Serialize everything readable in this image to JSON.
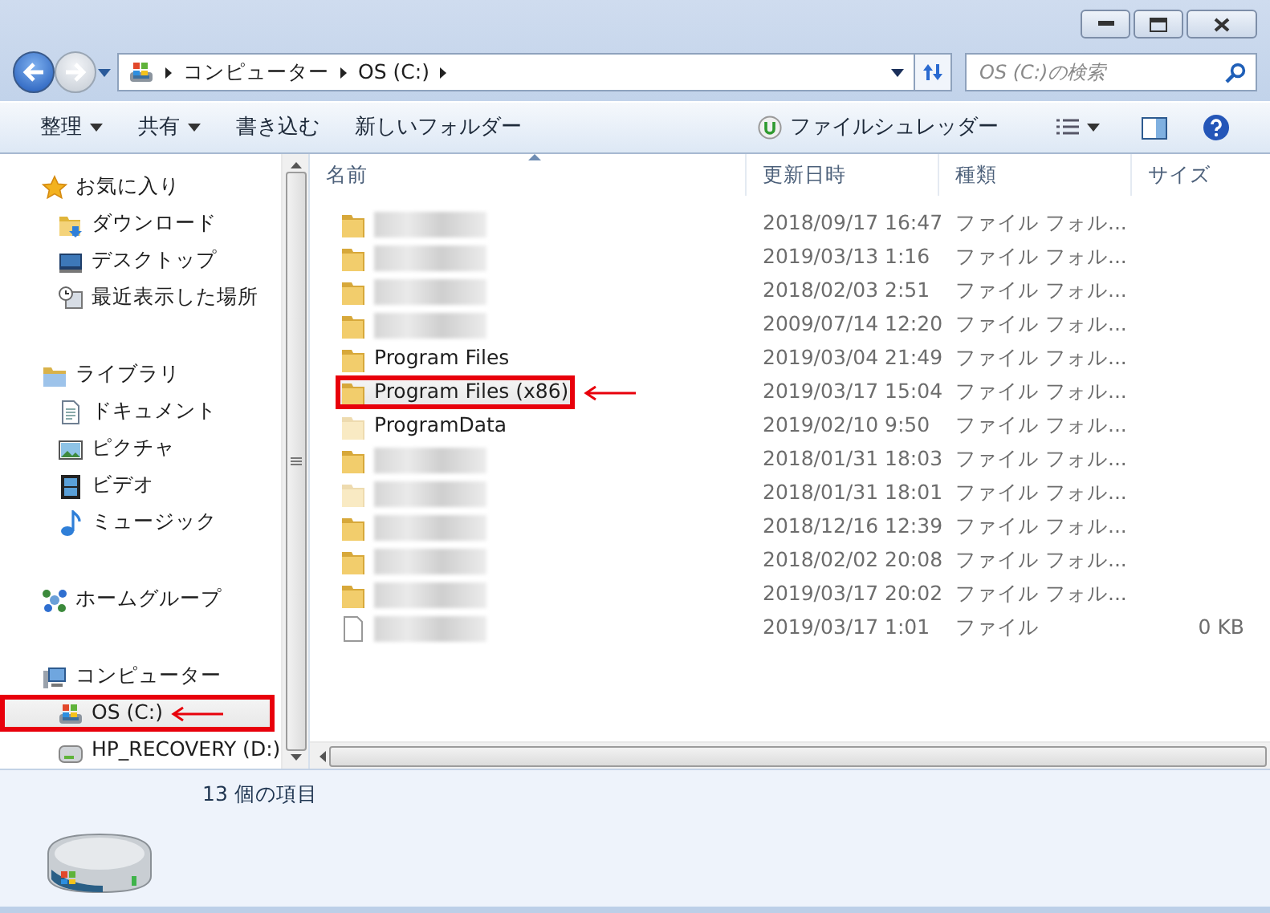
{
  "address_bar": {
    "crumbs": [
      "コンピューター",
      "OS (C:)"
    ]
  },
  "search": {
    "placeholder": "OS (C:)の検索"
  },
  "toolbar": {
    "items": [
      {
        "label": "整理",
        "dropdown": true
      },
      {
        "label": "共有",
        "dropdown": true
      },
      {
        "label": "書き込む",
        "dropdown": false
      },
      {
        "label": "新しいフォルダー",
        "dropdown": false
      }
    ],
    "shredder": "ファイルシュレッダー"
  },
  "nav": {
    "groups": [
      {
        "label": "お気に入り",
        "kind": "star",
        "highlighted": false,
        "children": [
          {
            "label": "ダウンロード",
            "kind": "download",
            "highlighted": false
          },
          {
            "label": "デスクトップ",
            "kind": "desktop",
            "highlighted": false
          },
          {
            "label": "最近表示した場所",
            "kind": "recent",
            "highlighted": false
          }
        ]
      },
      {
        "label": "ライブラリ",
        "kind": "library",
        "highlighted": false,
        "children": [
          {
            "label": "ドキュメント",
            "kind": "document",
            "highlighted": false
          },
          {
            "label": "ピクチャ",
            "kind": "picture",
            "highlighted": false
          },
          {
            "label": "ビデオ",
            "kind": "video",
            "highlighted": false
          },
          {
            "label": "ミュージック",
            "kind": "music",
            "highlighted": false
          }
        ]
      },
      {
        "label": "ホームグループ",
        "kind": "homegroup",
        "highlighted": false
      },
      {
        "label": "コンピューター",
        "kind": "computer",
        "highlighted": false,
        "children": [
          {
            "label": "OS (C:)",
            "kind": "drive",
            "highlighted": true
          },
          {
            "label": "HP_RECOVERY (D:)",
            "kind": "removable",
            "highlighted": false
          }
        ]
      }
    ]
  },
  "table": {
    "columns": [
      "名前",
      "更新日時",
      "種類",
      "サイズ"
    ],
    "rows": [
      {
        "kind": "folder",
        "blurred": true,
        "hidden": false,
        "highlighted": false,
        "modified": "2018/09/17 16:47",
        "type": "ファイル フォル..."
      },
      {
        "kind": "folder",
        "blurred": true,
        "hidden": false,
        "highlighted": false,
        "modified": "2019/03/13 1:16",
        "type": "ファイル フォル..."
      },
      {
        "kind": "folder",
        "blurred": true,
        "hidden": false,
        "highlighted": false,
        "modified": "2018/02/03 2:51",
        "type": "ファイル フォル..."
      },
      {
        "kind": "folder",
        "blurred": true,
        "hidden": false,
        "highlighted": false,
        "modified": "2009/07/14 12:20",
        "type": "ファイル フォル..."
      },
      {
        "kind": "folder",
        "name": "Program Files",
        "blurred": false,
        "hidden": false,
        "highlighted": false,
        "modified": "2019/03/04 21:49",
        "type": "ファイル フォル..."
      },
      {
        "kind": "folder",
        "name": "Program Files (x86)",
        "blurred": false,
        "hidden": false,
        "highlighted": true,
        "modified": "2019/03/17 15:04",
        "type": "ファイル フォル..."
      },
      {
        "kind": "folder",
        "name": "ProgramData",
        "blurred": false,
        "hidden": true,
        "highlighted": false,
        "modified": "2019/02/10 9:50",
        "type": "ファイル フォル..."
      },
      {
        "kind": "folder",
        "blurred": true,
        "hidden": false,
        "highlighted": false,
        "modified": "2018/01/31 18:03",
        "type": "ファイル フォル..."
      },
      {
        "kind": "folder",
        "blurred": true,
        "hidden": true,
        "highlighted": false,
        "modified": "2018/01/31 18:01",
        "type": "ファイル フォル..."
      },
      {
        "kind": "folder",
        "blurred": true,
        "hidden": false,
        "highlighted": false,
        "modified": "2018/12/16 12:39",
        "type": "ファイル フォル..."
      },
      {
        "kind": "folder",
        "blurred": true,
        "hidden": false,
        "highlighted": false,
        "modified": "2018/02/02 20:08",
        "type": "ファイル フォル..."
      },
      {
        "kind": "folder",
        "blurred": true,
        "hidden": false,
        "highlighted": false,
        "modified": "2019/03/17 20:02",
        "type": "ファイル フォル..."
      },
      {
        "kind": "file",
        "blurred": true,
        "hidden": false,
        "highlighted": false,
        "modified": "2019/03/17 1:01",
        "type": "ファイル",
        "size": "0 KB"
      }
    ]
  },
  "status": {
    "count": "13 個の項目"
  }
}
